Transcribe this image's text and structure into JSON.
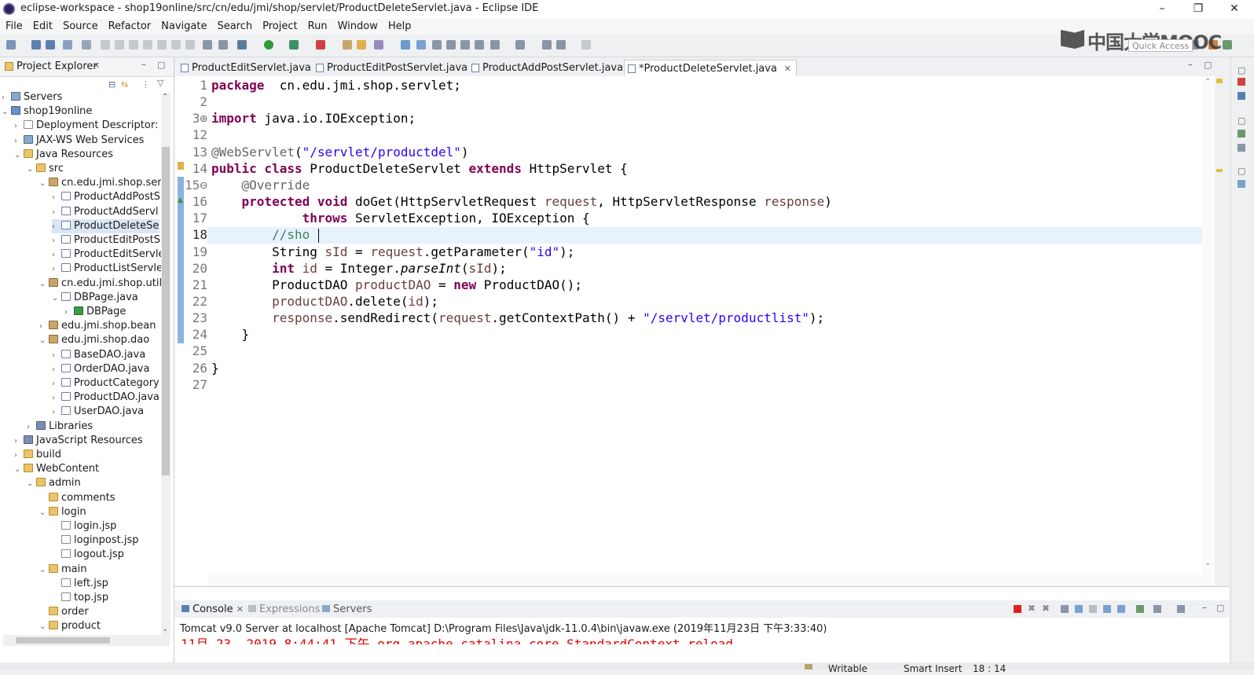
{
  "window": {
    "title": "eclipse-workspace - shop19online/src/cn/edu/jmi/shop/servlet/ProductDeleteServlet.java - Eclipse IDE",
    "minimize": "–",
    "restore": "❐",
    "close": "✕"
  },
  "menu": [
    "File",
    "Edit",
    "Source",
    "Refactor",
    "Navigate",
    "Search",
    "Project",
    "Run",
    "Window",
    "Help"
  ],
  "logo": "中国大学MOOC",
  "quick_access": {
    "placeholder": "Quick Access"
  },
  "explorer": {
    "title": "Project Explorer",
    "tree": [
      {
        "label": "Servers",
        "icon": "server",
        "chev": "›"
      },
      {
        "label": "shop19online",
        "icon": "project",
        "chev": "⌄"
      },
      {
        "label": "Deployment Descriptor: s",
        "icon": "file",
        "chev": "›"
      },
      {
        "label": "JAX-WS Web Services",
        "icon": "server",
        "chev": "›"
      },
      {
        "label": "Java Resources",
        "icon": "folder",
        "chev": "⌄"
      },
      {
        "label": "src",
        "icon": "folder",
        "chev": "⌄"
      },
      {
        "label": "cn.edu.jmi.shop.serv",
        "icon": "package",
        "chev": "⌄"
      },
      {
        "label": "ProductAddPostS",
        "icon": "java",
        "chev": "›"
      },
      {
        "label": "ProductAddServl",
        "icon": "java",
        "chev": "›"
      },
      {
        "label": "ProductDeleteSe",
        "icon": "java",
        "chev": "›",
        "selected": true
      },
      {
        "label": "ProductEditPostS",
        "icon": "java",
        "chev": "›"
      },
      {
        "label": "ProductEditServle",
        "icon": "java",
        "chev": "›"
      },
      {
        "label": "ProductListServle",
        "icon": "java",
        "chev": "›"
      },
      {
        "label": "cn.edu.jmi.shop.util",
        "icon": "package",
        "chev": "⌄"
      },
      {
        "label": "DBPage.java",
        "icon": "java",
        "chev": "⌄"
      },
      {
        "label": "DBPage",
        "icon": "class",
        "chev": "›"
      },
      {
        "label": "edu.jmi.shop.bean",
        "icon": "package",
        "chev": "›"
      },
      {
        "label": "edu.jmi.shop.dao",
        "icon": "package",
        "chev": "⌄"
      },
      {
        "label": "BaseDAO.java",
        "icon": "java",
        "chev": "›"
      },
      {
        "label": "OrderDAO.java",
        "icon": "java",
        "chev": "›"
      },
      {
        "label": "ProductCategory",
        "icon": "java",
        "chev": "›"
      },
      {
        "label": "ProductDAO.java",
        "icon": "java",
        "chev": "›"
      },
      {
        "label": "UserDAO.java",
        "icon": "java",
        "chev": "›"
      },
      {
        "label": "Libraries",
        "icon": "lib",
        "chev": "›"
      },
      {
        "label": "JavaScript Resources",
        "icon": "lib",
        "chev": "›"
      },
      {
        "label": "build",
        "icon": "folder",
        "chev": "›"
      },
      {
        "label": "WebContent",
        "icon": "folder",
        "chev": "⌄"
      },
      {
        "label": "admin",
        "icon": "folder",
        "chev": "⌄"
      },
      {
        "label": "comments",
        "icon": "folder",
        "chev": ""
      },
      {
        "label": "login",
        "icon": "folder",
        "chev": "⌄"
      },
      {
        "label": "login.jsp",
        "icon": "file",
        "chev": ""
      },
      {
        "label": "loginpost.jsp",
        "icon": "file",
        "chev": ""
      },
      {
        "label": "logout.jsp",
        "icon": "file",
        "chev": ""
      },
      {
        "label": "main",
        "icon": "folder",
        "chev": "⌄"
      },
      {
        "label": "left.jsp",
        "icon": "file",
        "chev": ""
      },
      {
        "label": "top.jsp",
        "icon": "file",
        "chev": ""
      },
      {
        "label": "order",
        "icon": "folder",
        "chev": ""
      },
      {
        "label": "product",
        "icon": "folder",
        "chev": "⌄"
      }
    ]
  },
  "editor": {
    "tabs": [
      {
        "label": "ProductEditServlet.java",
        "active": false
      },
      {
        "label": "ProductEditPostServlet.java",
        "active": false
      },
      {
        "label": "ProductAddPostServlet.java",
        "active": false
      },
      {
        "label": "*ProductDeleteServlet.java",
        "active": true
      }
    ],
    "lines": [
      {
        "n": "1",
        "t": [
          [
            "kw",
            "package"
          ],
          [
            "",
            "  cn.edu.jmi.shop.servlet;"
          ]
        ]
      },
      {
        "n": "2",
        "t": []
      },
      {
        "n": "3⊕",
        "t": [
          [
            "kw",
            "import"
          ],
          [
            "",
            " java.io.IOException;"
          ]
        ]
      },
      {
        "n": "12",
        "t": []
      },
      {
        "n": "13",
        "t": [
          [
            "ann",
            "@WebServlet"
          ],
          [
            "",
            "("
          ],
          [
            "str",
            "\"/servlet/productdel\""
          ],
          [
            "",
            ")"
          ]
        ]
      },
      {
        "n": "14",
        "t": [
          [
            "kw",
            "public class"
          ],
          [
            "",
            " ProductDeleteServlet "
          ],
          [
            "kw",
            "extends"
          ],
          [
            "",
            " HttpServlet {"
          ]
        ]
      },
      {
        "n": "15⊖",
        "t": [
          [
            "",
            "    "
          ],
          [
            "ann",
            "@Override"
          ]
        ]
      },
      {
        "n": "16",
        "t": [
          [
            "",
            "    "
          ],
          [
            "kw",
            "protected void"
          ],
          [
            "",
            " doGet(HttpServletRequest "
          ],
          [
            "var",
            "request"
          ],
          [
            "",
            ", HttpServletResponse "
          ],
          [
            "var",
            "response"
          ],
          [
            "",
            ")"
          ]
        ]
      },
      {
        "n": "17",
        "t": [
          [
            "",
            "            "
          ],
          [
            "kw",
            "throws"
          ],
          [
            "",
            " ServletException, IOException {"
          ]
        ]
      },
      {
        "n": "18",
        "t": [
          [
            "",
            "        "
          ],
          [
            "cm",
            "//sho"
          ]
        ]
      },
      {
        "n": "19",
        "t": [
          [
            "",
            "        String "
          ],
          [
            "var",
            "sId"
          ],
          [
            "",
            " = "
          ],
          [
            "var",
            "request"
          ],
          [
            "",
            ".getParameter("
          ],
          [
            "str",
            "\"id\""
          ],
          [
            "",
            ");"
          ]
        ]
      },
      {
        "n": "20",
        "t": [
          [
            "",
            "        "
          ],
          [
            "kw",
            "int"
          ],
          [
            "",
            " "
          ],
          [
            "var",
            "id"
          ],
          [
            "",
            " = Integer."
          ],
          [
            "it",
            "parseInt"
          ],
          [
            "",
            "("
          ],
          [
            "var",
            "sId"
          ],
          [
            "",
            ");"
          ]
        ]
      },
      {
        "n": "21",
        "t": [
          [
            "",
            "        ProductDAO "
          ],
          [
            "var",
            "productDAO"
          ],
          [
            "",
            " = "
          ],
          [
            "kw",
            "new"
          ],
          [
            "",
            " ProductDAO();"
          ]
        ]
      },
      {
        "n": "22",
        "t": [
          [
            "",
            "        "
          ],
          [
            "var",
            "productDAO"
          ],
          [
            "",
            ".delete("
          ],
          [
            "var",
            "id"
          ],
          [
            "",
            ");"
          ]
        ]
      },
      {
        "n": "23",
        "t": [
          [
            "",
            "        "
          ],
          [
            "var",
            "response"
          ],
          [
            "",
            ".sendRedirect("
          ],
          [
            "var",
            "request"
          ],
          [
            "",
            ".getContextPath() + "
          ],
          [
            "str",
            "\"/servlet/productlist\""
          ],
          [
            "",
            ");"
          ]
        ]
      },
      {
        "n": "24",
        "t": [
          [
            "",
            "    }"
          ]
        ]
      },
      {
        "n": "25",
        "t": []
      },
      {
        "n": "26",
        "t": [
          [
            "",
            "}"
          ]
        ]
      },
      {
        "n": "27",
        "t": []
      }
    ]
  },
  "console": {
    "tabs": [
      {
        "label": "Console"
      },
      {
        "label": "Expressions"
      },
      {
        "label": "Servers"
      }
    ],
    "description": "Tomcat v9.0 Server at localhost [Apache Tomcat] D:\\Program Files\\Java\\jdk-11.0.4\\bin\\javaw.exe (2019年11月23日 下午3:33:40)",
    "log_line": "11月 23, 2019 8:44:41 下午 org.apache.catalina.core.StandardContext reload"
  },
  "status": {
    "writable": "Writable",
    "insert_mode": "Smart Insert",
    "position": "18 : 14"
  },
  "colors": {
    "keyword": "#7f0055",
    "string": "#2a00ff",
    "annotation": "#646464",
    "variable": "#6a3e3e",
    "comment": "#3f7f5f",
    "current_line": "#e8f2fe",
    "console_error": "#e00000"
  }
}
